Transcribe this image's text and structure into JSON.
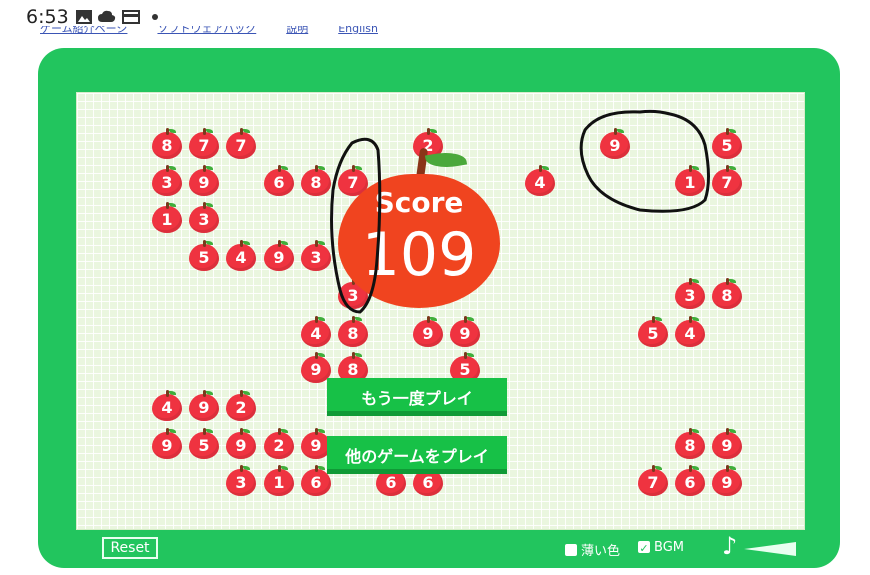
{
  "status_bar": {
    "time": "6:53",
    "icons": [
      "image-icon",
      "cloud-icon",
      "card-icon",
      "dot-icon"
    ]
  },
  "top_links": [
    "ゲーム紹介ページ",
    "ソフトウェアパック",
    "説明",
    "English"
  ],
  "score": {
    "label": "Score",
    "value": "109"
  },
  "buttons": {
    "play_again": "もう一度プレイ",
    "other_games": "他のゲームをプレイ",
    "reset": "Reset"
  },
  "options": {
    "light_color": {
      "label": "薄い色",
      "checked": false
    },
    "bgm": {
      "label": "BGM",
      "checked": true
    }
  },
  "colors": {
    "frame": "#22c55e",
    "apple": "#ef3340",
    "board": "#eaf6df",
    "button": "#17c147"
  },
  "apples": [
    "8",
    "7",
    "7",
    "2",
    "9",
    "5",
    "3",
    "9",
    "6",
    "8",
    "7",
    "4",
    "1",
    "7",
    "1",
    "3",
    "5",
    "4",
    "9",
    "3",
    "3",
    "3",
    "8",
    "4",
    "8",
    "9",
    "9",
    "5",
    "4",
    "9",
    "8",
    "5",
    "4",
    "9",
    "2",
    "9",
    "5",
    "9",
    "2",
    "9",
    "8",
    "9",
    "3",
    "1",
    "6",
    "6",
    "6",
    "7",
    "6",
    "9"
  ]
}
